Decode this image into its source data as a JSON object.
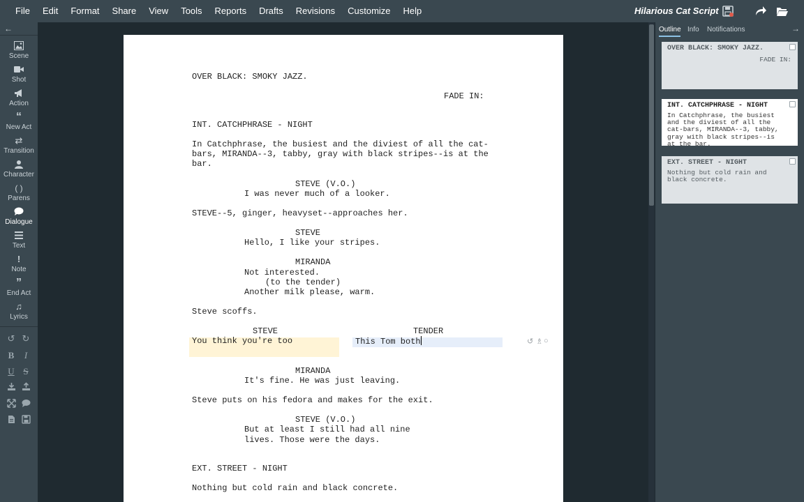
{
  "menu": [
    "File",
    "Edit",
    "Format",
    "Share",
    "View",
    "Tools",
    "Reports",
    "Drafts",
    "Revisions",
    "Customize",
    "Help"
  ],
  "title": "Hilarious Cat Script",
  "toolbar_icons": [
    "save-icon",
    "redo-share-icon",
    "folder-open-icon"
  ],
  "left_tools": [
    {
      "label": "Scene",
      "icon": "image-icon"
    },
    {
      "label": "Shot",
      "icon": "video-icon"
    },
    {
      "label": "Action",
      "icon": "megaphone-icon"
    },
    {
      "label": "New Act",
      "icon": "quote-icon"
    },
    {
      "label": "Transition",
      "icon": "transition-arrows-icon"
    },
    {
      "label": "Character",
      "icon": "person-icon"
    },
    {
      "label": "Parens",
      "icon": "parens-icon",
      "glyph": "( )"
    },
    {
      "label": "Dialogue",
      "icon": "speech-bubble-icon"
    },
    {
      "label": "Text",
      "icon": "lines-icon"
    },
    {
      "label": "Note",
      "icon": "exclamation-icon",
      "glyph": "!"
    },
    {
      "label": "End Act",
      "icon": "end-quote-icon"
    },
    {
      "label": "Lyrics",
      "icon": "music-note-icon"
    }
  ],
  "active_tool": "Dialogue",
  "script": {
    "l1": "OVER BLACK: SMOKY JAZZ.",
    "l2": "FADE IN:",
    "l3": "INT. CATCHPHRASE - NIGHT",
    "l4": "In Catchphrase, the busiest and the diviest of all the cat-",
    "l5": "bars, MIRANDA--3, tabby, gray with black stripes--is at the",
    "l6": "bar.",
    "l7": "STEVE (V.O.)",
    "l8": "I was never much of a looker.",
    "l9": "STEVE--5, ginger, heavyset--approaches her.",
    "l10": "STEVE",
    "l11": "Hello, I like your stripes.",
    "l12": "MIRANDA",
    "l13": "Not interested.",
    "l14": "(to the tender)",
    "l15": "Another milk please, warm.",
    "l16": "Steve scoffs.",
    "dual_left_char": "STEVE",
    "dual_left_text": "You think you're too",
    "dual_right_char": "TENDER",
    "dual_right_text": "This Tom both",
    "l17": "MIRANDA",
    "l18": "It's fine. He was just leaving.",
    "l19": "Steve puts on his fedora and makes for the exit.",
    "l20": "STEVE (V.O.)",
    "l21": "But at least I still had all nine",
    "l22": "lives. Those were the days.",
    "l23": "EXT. STREET - NIGHT",
    "l24": "Nothing but cold rain and black concrete."
  },
  "panel": {
    "tabs": [
      "Outline",
      "Info",
      "Notifications"
    ],
    "active_tab": "Outline",
    "cards": [
      {
        "title": "OVER BLACK: SMOKY JAZZ.",
        "right": "FADE IN:",
        "body": ""
      },
      {
        "title": "INT. CATCHPHRASE - NIGHT",
        "body": "In Catchphrase, the busiest\nand the diviest of all the\ncat-bars, MIRANDA--3, tabby,\ngray with black stripes--is\nat the bar."
      },
      {
        "title": "EXT. STREET - NIGHT",
        "body": "Nothing but cold rain and\nblack concrete."
      }
    ]
  }
}
